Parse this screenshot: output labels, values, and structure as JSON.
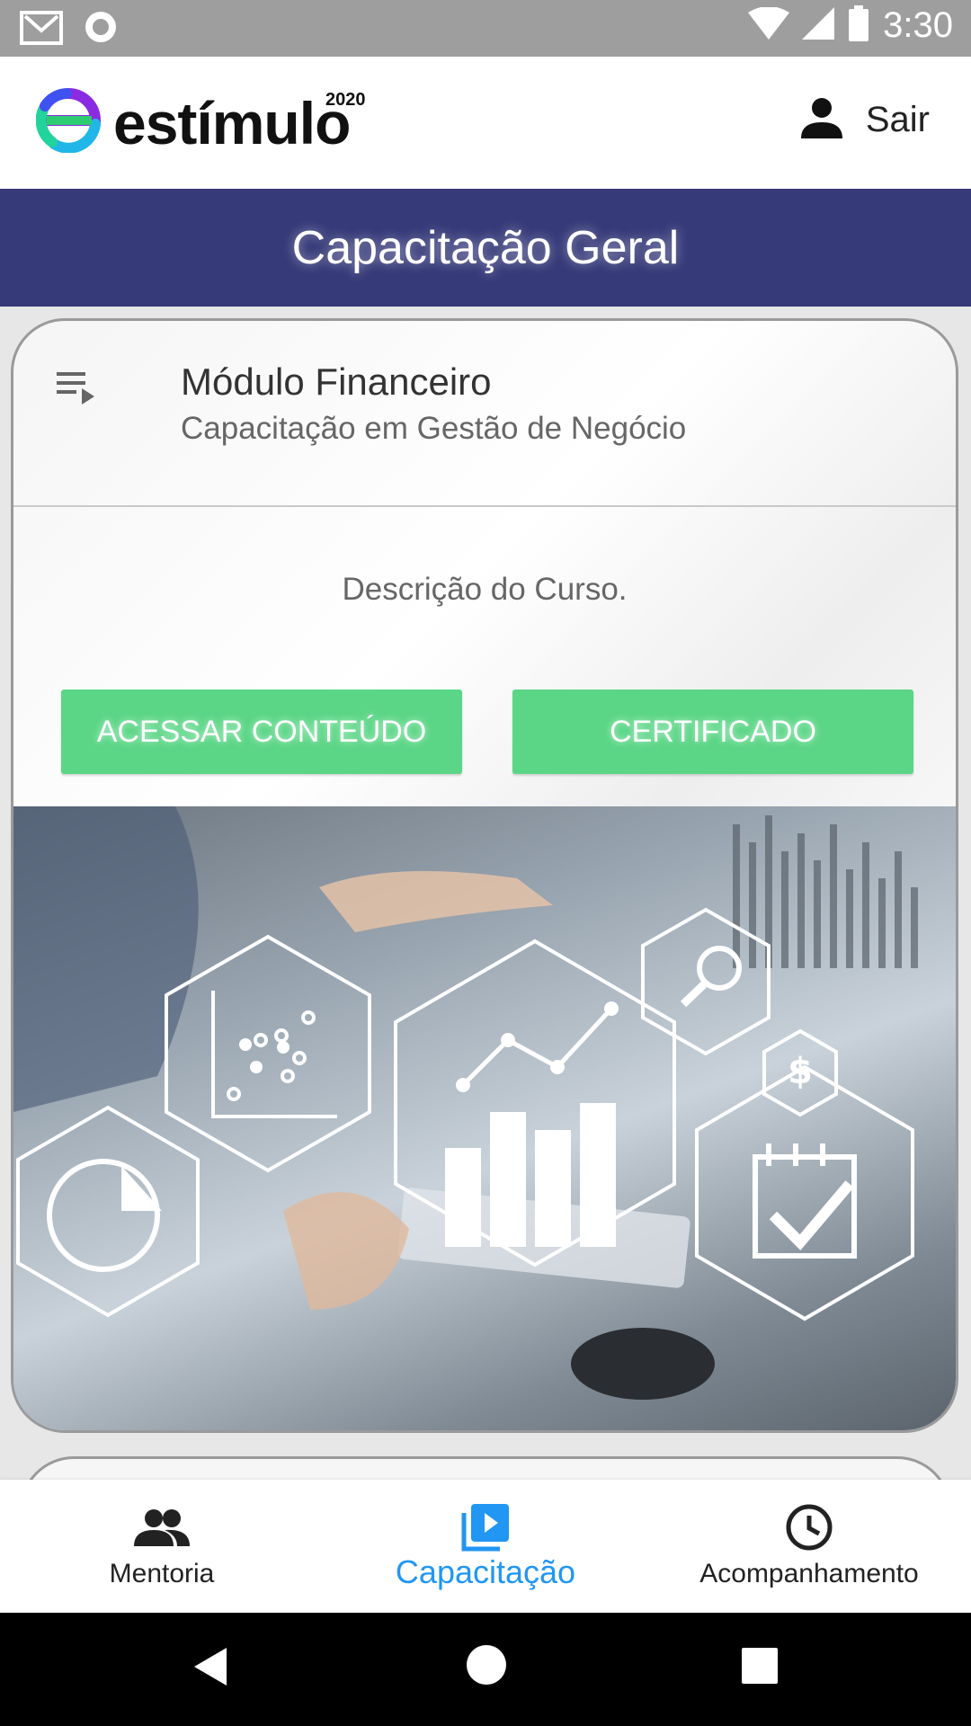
{
  "status_bar": {
    "time": "3:30",
    "icons": [
      "gmail-icon",
      "record-icon",
      "wifi-icon",
      "signal-icon",
      "battery-icon"
    ]
  },
  "header": {
    "logo_text": "estímulo",
    "logo_year": "2020",
    "logout_label": "Sair",
    "logout_icon": "person-icon"
  },
  "page": {
    "title": "Capacitação Geral"
  },
  "course": {
    "title": "Módulo Financeiro",
    "subtitle": "Capacitação em Gestão de Negócio",
    "description": "Descrição do Curso.",
    "access_button": "ACESSAR CONTEÚDO",
    "certificate_button": "CERTIFICADO",
    "icon": "playlist-icon"
  },
  "bottom_nav": {
    "items": [
      {
        "label": "Mentoria",
        "icon": "people-icon",
        "active": false
      },
      {
        "label": "Capacitação",
        "icon": "video-library-icon",
        "active": true
      },
      {
        "label": "Acompanhamento",
        "icon": "clock-icon",
        "active": false
      }
    ]
  },
  "colors": {
    "title_bar": "#363a78",
    "button": "#5bd686",
    "active_nav": "#2196f3",
    "status_bar": "#9e9e9e"
  }
}
